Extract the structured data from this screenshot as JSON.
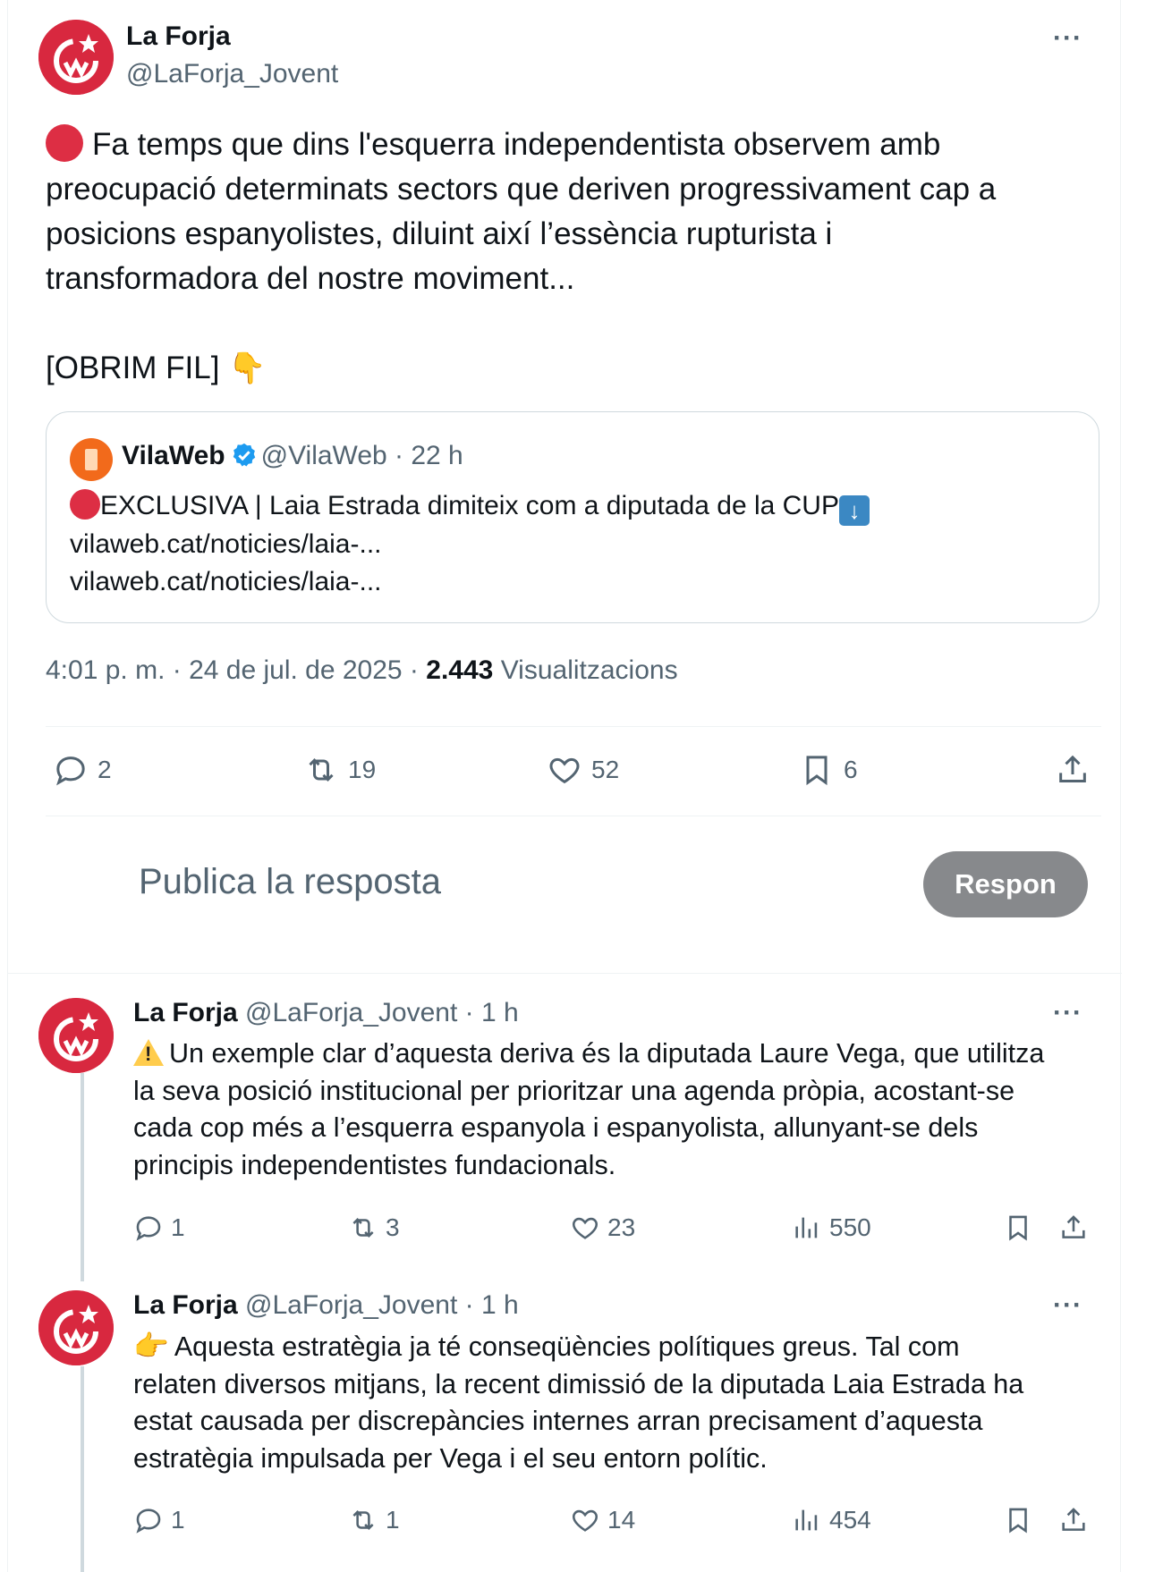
{
  "main_tweet": {
    "author_name": "La Forja",
    "author_handle": "@LaForja_Jovent",
    "more_label": "···",
    "text_line1": "Fa temps que dins l'esquerra independentista observem amb",
    "text_line2": "preocupació determinats sectors que deriven progressivament cap a",
    "text_line3": "posicions espanyolistes, diluint així l’essència rupturista i",
    "text_line4": "transformadora del nostre moviment...",
    "thread_label": "[OBRIM FIL]",
    "quote": {
      "name": "VilaWeb",
      "handle_time": "@VilaWeb · 22 h",
      "text": "EXCLUSIVA | Laia Estrada dimiteix com a diputada de la CUP",
      "link1": "vilaweb.cat/noticies/laia-...",
      "link2": "vilaweb.cat/noticies/laia-..."
    },
    "timestamp": "4:01 p. m. · 24 de jul. de 2025 · ",
    "views_count": "2.443",
    "views_label": "Visualitzacions",
    "actions": {
      "replies": "2",
      "reposts": "19",
      "likes": "52",
      "bookmarks": "6"
    }
  },
  "reply_composer": {
    "placeholder": "Publica la resposta",
    "button_label": "Respon"
  },
  "thread_replies": [
    {
      "author_name": "La Forja",
      "meta": "@LaForja_Jovent · 1 h",
      "line1": "Un exemple clar d’aquesta deriva és la diputada Laure Vega, que utilitza",
      "line2": "la seva posició institucional per prioritzar una agenda pròpia, acostant-se",
      "line3": "cada cop més a l’esquerra espanyola i espanyolista, allunyant-se dels",
      "line4": "principis independentistes fundacionals.",
      "replies": "1",
      "reposts": "3",
      "likes": "23",
      "views": "550"
    },
    {
      "author_name": "La Forja",
      "meta": "@LaForja_Jovent · 1 h",
      "line1": "Aquesta estratègia ja té conseqüències polítiques greus. Tal com",
      "line2": "relaten diversos mitjans, la recent dimissió de la diputada Laia Estrada ha",
      "line3": "estat causada per discrepàncies internes arran precisament d’aquesta",
      "line4": "estratègia impulsada per Vega i el seu entorn polític.",
      "replies": "1",
      "reposts": "1",
      "likes": "14",
      "views": "454"
    }
  ]
}
